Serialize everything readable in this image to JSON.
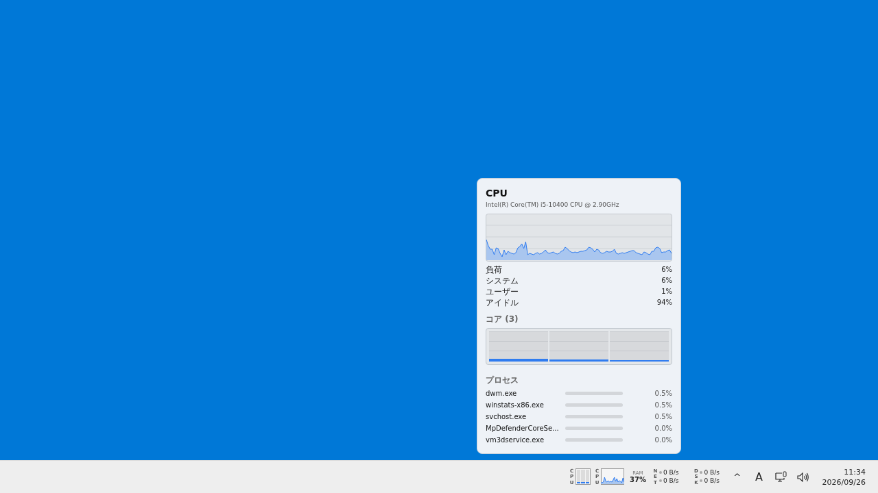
{
  "flyout": {
    "title": "CPU",
    "subtitle": "Intel(R) Core(TM) i5-10400 CPU @ 2.90GHz",
    "stats": [
      {
        "label": "負荷",
        "value": "6%"
      },
      {
        "label": "システム",
        "value": "6%"
      },
      {
        "label": "ユーザー",
        "value": "1%"
      },
      {
        "label": "アイドル",
        "value": "94%"
      }
    ],
    "cores_title": "コア (3)",
    "processes_title": "プロセス",
    "processes": [
      {
        "name": "dwm.exe",
        "value": "0.5%"
      },
      {
        "name": "winstats-x86.exe",
        "value": "0.5%"
      },
      {
        "name": "svchost.exe",
        "value": "0.5%"
      },
      {
        "name": "MpDefenderCoreSe...",
        "value": "0.0%"
      },
      {
        "name": "vm3dservice.exe",
        "value": "0.0%"
      }
    ]
  },
  "taskbar": {
    "widgets": [
      {
        "kind": "bars",
        "label": "CPU"
      },
      {
        "kind": "graph",
        "label": "CPU"
      },
      {
        "kind": "ram",
        "label": "RAM",
        "value": "37%"
      },
      {
        "kind": "io",
        "label": "NET",
        "up": "0 B/s",
        "down": "0 B/s"
      },
      {
        "kind": "io",
        "label": "DSK",
        "up": "0 B/s",
        "down": "0 B/s"
      }
    ],
    "tray": {
      "chevron": "^",
      "ime": "A"
    },
    "time": "11:34",
    "date": "2026/09/26"
  }
}
